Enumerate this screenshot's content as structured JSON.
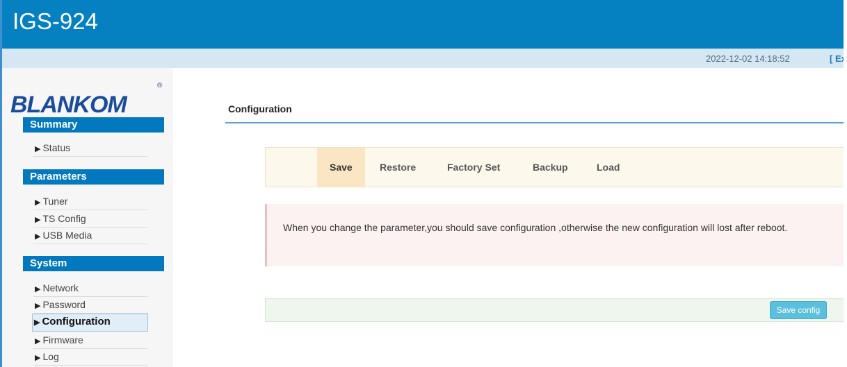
{
  "header": {
    "title": "IGS-924"
  },
  "infobar": {
    "datetime": "2022-12-02 14:18:52",
    "exit_label": "[ Ex"
  },
  "logo": {
    "text": "BLANKOM",
    "registered": "®"
  },
  "sidebar": {
    "sections": [
      {
        "title": "Summary",
        "items": [
          {
            "label": "Status",
            "icon": "triangle-right-icon"
          }
        ]
      },
      {
        "title": "Parameters",
        "items": [
          {
            "label": "Tuner",
            "icon": "triangle-right-icon"
          },
          {
            "label": "TS Config",
            "icon": "triangle-right-icon"
          },
          {
            "label": "USB Media",
            "icon": "triangle-right-icon"
          }
        ]
      },
      {
        "title": "System",
        "items": [
          {
            "label": "Network",
            "icon": "triangle-right-icon"
          },
          {
            "label": "Password",
            "icon": "triangle-right-icon"
          },
          {
            "label": "Configuration",
            "icon": "triangle-right-icon",
            "active": true
          },
          {
            "label": "Firmware",
            "icon": "triangle-right-icon"
          },
          {
            "label": "Log",
            "icon": "triangle-right-icon"
          }
        ]
      }
    ]
  },
  "main": {
    "title": "Configuration",
    "tabs": [
      {
        "label": "Save",
        "active": true
      },
      {
        "label": "Restore"
      },
      {
        "label": "Factory Set"
      },
      {
        "label": "Backup"
      },
      {
        "label": "Load"
      }
    ],
    "alert": "When you change the parameter,you should save configuration ,otherwise the new configuration will lost after reboot.",
    "save_button": "Save config"
  },
  "colors": {
    "header": "#0580c0",
    "infobar": "#d5e7f2",
    "section_head": "#0278bf",
    "tab_active": "#fbe6c4",
    "alert_bg": "#fcf2f2",
    "button": "#5bbfde"
  }
}
